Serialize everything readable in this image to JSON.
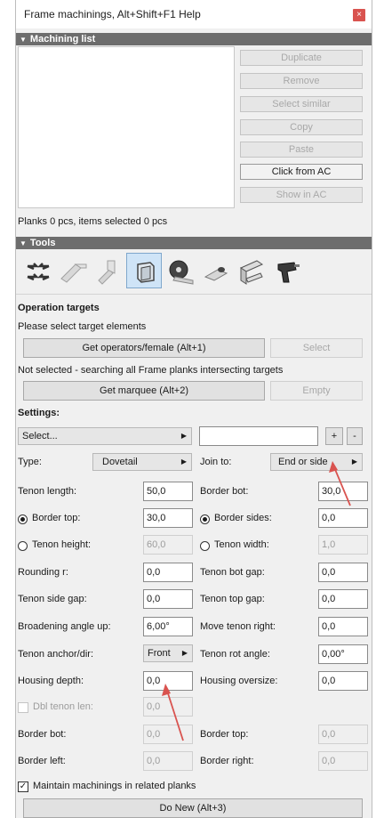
{
  "window": {
    "title": "Frame machinings, Alt+Shift+F1 Help",
    "close_glyph": "×"
  },
  "machining_list": {
    "header": "Machining list",
    "buttons": {
      "duplicate": "Duplicate",
      "remove": "Remove",
      "select_similar": "Select similar",
      "copy": "Copy",
      "paste": "Paste",
      "click_from_ac": "Click from AC",
      "show_in_ac": "Show in AC"
    },
    "status": "Planks 0 pcs, items selected 0 pcs"
  },
  "tools": {
    "header": "Tools",
    "icons": [
      "dovetail-arrows-icon",
      "beam-plank-icon",
      "beam-angle-icon",
      "tenon-block-icon",
      "saw-blade-icon",
      "drill-bit-icon",
      "corner-joint-icon",
      "power-drill-icon"
    ],
    "selected_index": 3
  },
  "operation_targets": {
    "heading": "Operation targets",
    "instruction": "Please select target elements",
    "get_operators_btn": "Get operators/female (Alt+1)",
    "select_btn": "Select",
    "searching_text": "Not selected - searching all Frame planks intersecting targets",
    "get_marquee_btn": "Get marquee (Alt+2)",
    "empty_btn": "Empty"
  },
  "settings": {
    "heading": "Settings:",
    "preset_select": "Select...",
    "preset_name": "",
    "add_btn": "+",
    "remove_btn": "-",
    "type_label": "Type:",
    "type_value": "Dovetail",
    "join_label": "Join to:",
    "join_value": "End or side",
    "tenon_length_label": "Tenon length:",
    "tenon_length": "50,0",
    "border_bot_label": "Border bot:",
    "border_bot": "30,0",
    "border_top_label": "Border top:",
    "border_top": "30,0",
    "border_sides_label": "Border sides:",
    "border_sides": "0,0",
    "tenon_height_label": "Tenon height:",
    "tenon_height": "60,0",
    "tenon_width_label": "Tenon width:",
    "tenon_width": "1,0",
    "rounding_label": "Rounding r:",
    "rounding": "0,0",
    "tenon_bot_gap_label": "Tenon bot gap:",
    "tenon_bot_gap": "0,0",
    "tenon_side_gap_label": "Tenon side gap:",
    "tenon_side_gap": "0,0",
    "tenon_top_gap_label": "Tenon top gap:",
    "tenon_top_gap": "0,0",
    "broadening_label": "Broadening angle up:",
    "broadening": "6,00°",
    "move_tenon_right_label": "Move tenon right:",
    "move_tenon_right": "0,0",
    "anchor_label": "Tenon anchor/dir:",
    "anchor_value": "Front",
    "rot_angle_label": "Tenon rot angle:",
    "rot_angle": "0,00°",
    "housing_depth_label": "Housing depth:",
    "housing_depth": "0,0",
    "housing_oversize_label": "Housing oversize:",
    "housing_oversize": "0,0",
    "dbl_tenon_label": "Dbl tenon len:",
    "dbl_tenon": "0,0",
    "lower_border_bot_label": "Border bot:",
    "lower_border_bot": "0,0",
    "lower_border_top_label": "Border top:",
    "lower_border_top": "0,0",
    "border_left_label": "Border left:",
    "border_left": "0,0",
    "border_right_label": "Border right:",
    "border_right": "0,0",
    "maintain_label": "Maintain machinings in related planks",
    "maintain_checked": true,
    "do_new_btn": "Do New (Alt+3)"
  },
  "colors": {
    "header_bg": "#6d6d6d",
    "close_bg": "#d9534f",
    "selected_tool": "#cfe4f7",
    "annotation_arrow": "#d9534f"
  }
}
